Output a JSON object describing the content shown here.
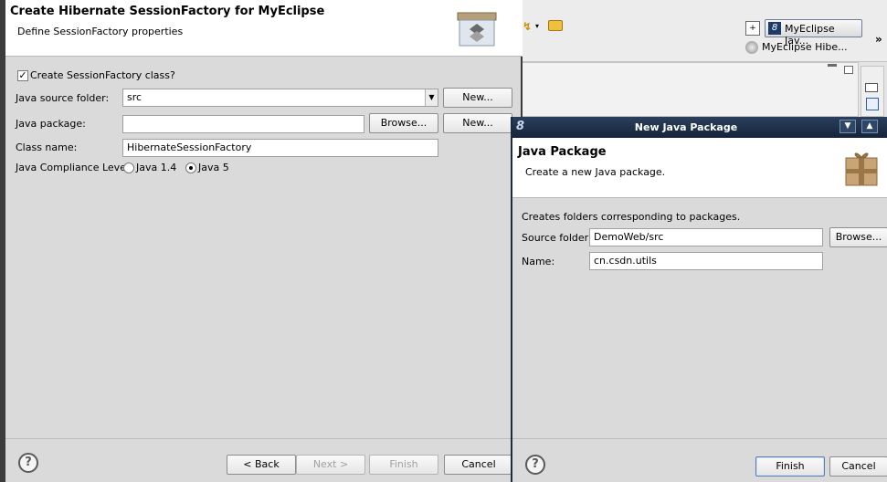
{
  "ide": {
    "perspective_active": "MyEclipse Jav...",
    "perspective_other": "MyEclipse Hibe...",
    "overflow": "»"
  },
  "dialog1": {
    "title": "Create Hibernate SessionFactory for MyEclipse",
    "subtitle": "Define SessionFactory properties",
    "create_class_label": "Create SessionFactory class?",
    "create_class_checked": true,
    "source_folder_label": "Java source folder:",
    "source_folder_value": "src",
    "new_button_1": "New...",
    "package_label": "Java package:",
    "package_value": "",
    "browse_button": "Browse...",
    "new_button_2": "New...",
    "class_name_label": "Class name:",
    "class_name_value": "HibernateSessionFactory",
    "compliance_label": "Java Compliance Level:",
    "compliance_options": [
      "Java 1.4",
      "Java 5"
    ],
    "compliance_selected": "Java 5",
    "help": "?",
    "back_button": "< Back",
    "next_button": "Next >",
    "finish_button": "Finish",
    "cancel_button": "Cancel"
  },
  "dialog2": {
    "window_title": "New Java Package",
    "heading": "Java Package",
    "subtitle": "Create a new Java package.",
    "description": "Creates folders corresponding to packages.",
    "source_folder_label": "Source folder:",
    "source_folder_value": "DemoWeb/src",
    "browse_button": "Browse...",
    "name_label": "Name:",
    "name_value": "cn.csdn.utils",
    "help": "?",
    "finish_button": "Finish",
    "cancel_button": "Cancel"
  }
}
